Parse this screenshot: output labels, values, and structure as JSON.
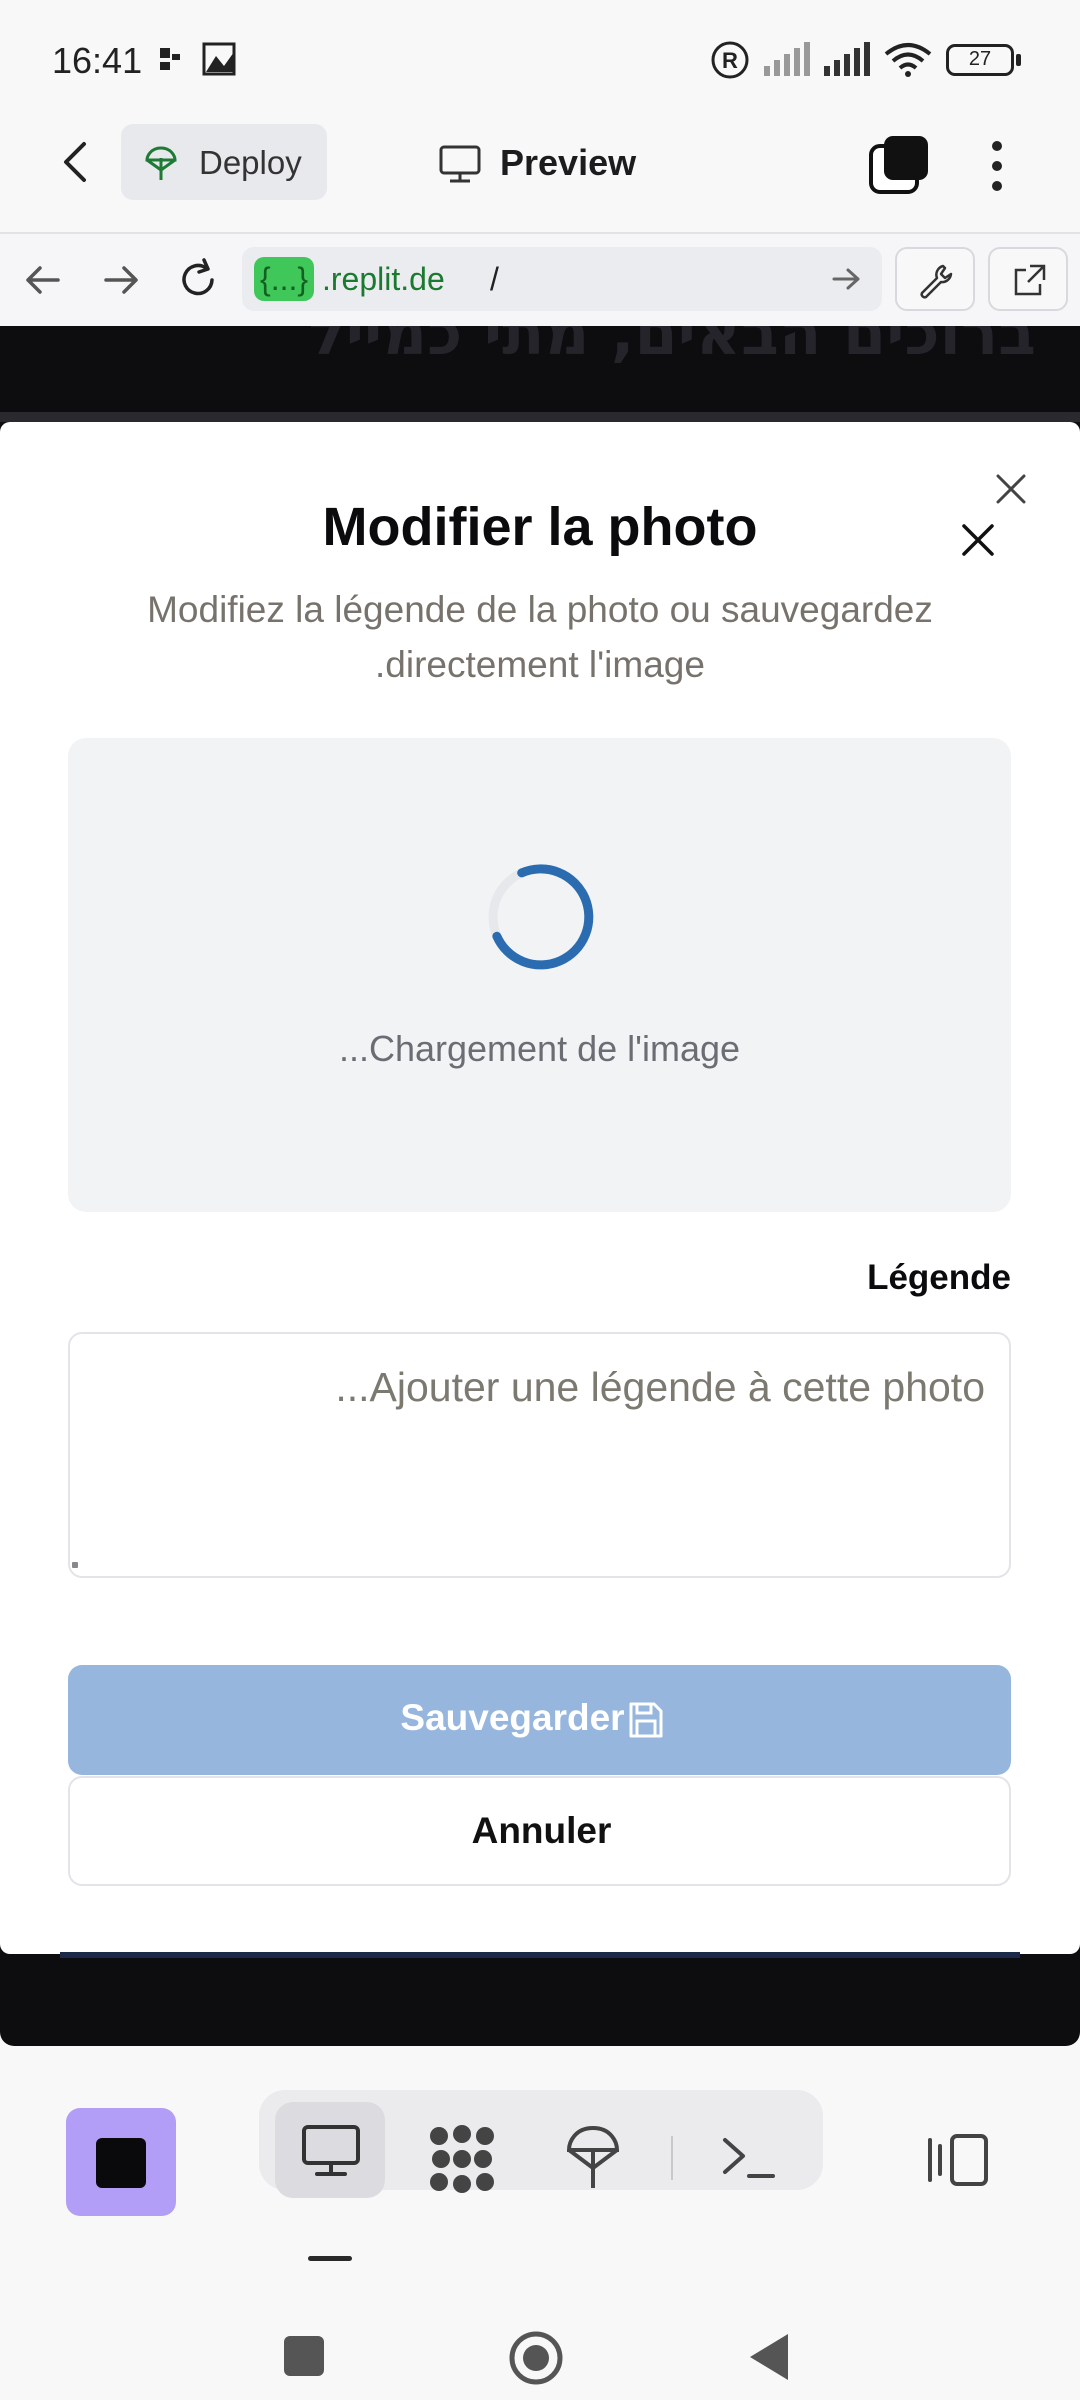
{
  "status_bar": {
    "time": "16:41",
    "battery": "27",
    "icons": [
      "notification-icon",
      "image-icon",
      "registered-icon",
      "signal-icon",
      "signal-icon",
      "wifi-icon",
      "battery-icon"
    ]
  },
  "top_bar": {
    "deploy_label": "Deploy",
    "preview_label": "Preview"
  },
  "url_bar": {
    "chip": "{...}",
    "domain": ".replit.de",
    "path": "/"
  },
  "page": {
    "heading": "ברוכים הבאים, מתי כמייל"
  },
  "modal": {
    "title": "Modifier la photo",
    "description": "Modifiez la légende de la photo ou sauvegardez .directement l'image",
    "loading_text": "...Chargement de l'image",
    "caption_label": "Légende",
    "caption_placeholder": "...Ajouter une légende à cette photo",
    "save_label": "Sauvegarder",
    "cancel_label": "Annuler"
  },
  "colors": {
    "accent": "#2b6cb0",
    "save_button": "#96b6de",
    "stop_button": "#b39ef7",
    "url_chip": "#3fc75a"
  }
}
